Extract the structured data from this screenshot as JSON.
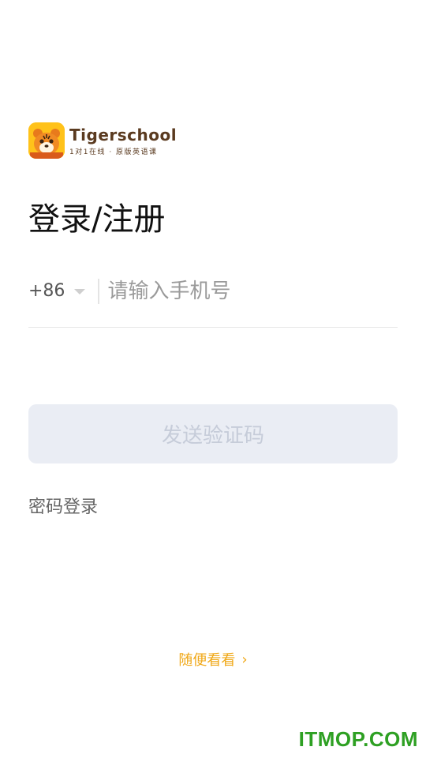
{
  "brand": {
    "name": "Tigerschool",
    "slogan": "1对1在线 · 原版英语课",
    "logo_icon": "tiger-mascot-icon"
  },
  "page_title": "登录/注册",
  "phone": {
    "country_code": "+86",
    "placeholder": "请输入手机号",
    "value": ""
  },
  "send_button_label": "发送验证码",
  "password_login_label": "密码登录",
  "browse_link_label": "随便看看",
  "browse_link_chevron": "›",
  "watermark": "ITMOP.COM",
  "colors": {
    "accent": "#f0a818",
    "button_bg": "#eaedf4",
    "button_text": "#c6ccd9",
    "watermark": "#2ea023",
    "logo_bg": "#ffc21a"
  }
}
